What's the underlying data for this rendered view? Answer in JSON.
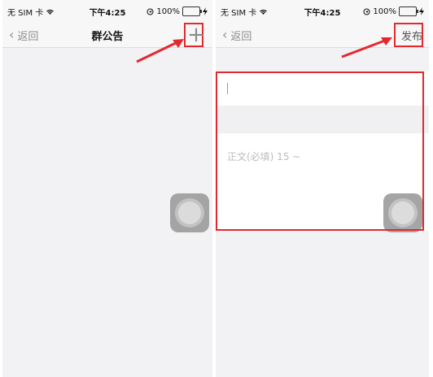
{
  "left_screen": {
    "status": {
      "carrier": "无 SIM 卡",
      "time": "下午4:25",
      "battery": "100%"
    },
    "nav": {
      "back_label": "返回",
      "title": "群公告",
      "action_symbol": "+"
    }
  },
  "right_screen": {
    "status": {
      "carrier": "无 SIM 卡",
      "time": "下午4:25",
      "battery": "100%"
    },
    "nav": {
      "back_label": "返回",
      "action_label": "发布"
    },
    "form": {
      "body_placeholder": "正文(必填) 15 ~"
    }
  },
  "colors": {
    "highlight": "#e3292f",
    "background": "#f2f2f4"
  },
  "icons": [
    "back-chevron-icon",
    "wifi-icon",
    "location-icon",
    "battery-icon",
    "charging-icon",
    "plus-icon",
    "assistive-touch-icon",
    "arrow-icon"
  ]
}
